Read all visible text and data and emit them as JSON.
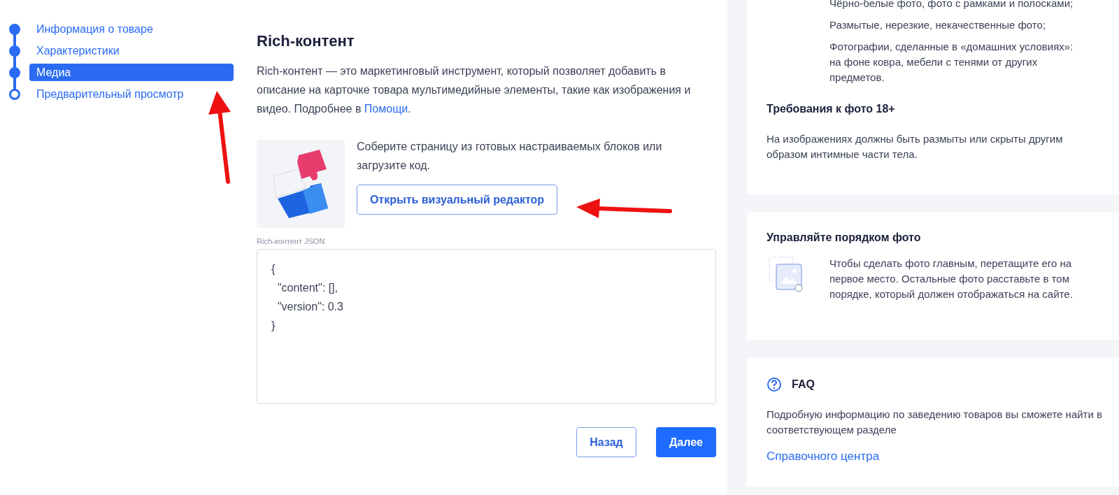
{
  "steps": [
    {
      "label": "Информация о товаре",
      "done": true,
      "selected": false
    },
    {
      "label": "Характеристики",
      "done": true,
      "selected": false
    },
    {
      "label": "Медиа",
      "done": true,
      "selected": true
    },
    {
      "label": "Предварительный просмотр",
      "done": false,
      "selected": false
    }
  ],
  "main": {
    "title": "Rich-контент",
    "description": "Rich-контент — это маркетинговый инструмент, который позволяет добавить в описание на карточке товара мультимедийные элементы, такие как изображения и видео. Подробнее в ",
    "help_link": "Помощи",
    "description_end": ".",
    "editor_text": "Соберите страницу из готовых настраиваемых блоков или загрузите код.",
    "editor_button": "Открыть визуальный редактор",
    "json_label": "Rich-контент JSON",
    "json_value": "{\n  \"content\": [],\n  \"version\": 0.3\n}",
    "back_button": "Назад",
    "next_button": "Далее"
  },
  "side": {
    "bullets": [
      "Чёрно-белые фото, фото с рамками и полосками;",
      "Размытые, нерезкие, некачественные фото;",
      "Фотографии, сделанные в «домашних условиях»: на фоне ковра, мебели с тенями от других предметов."
    ],
    "adult_title": "Требования к фото 18+",
    "adult_text": "На изображениях должны быть размыты или скрыты другим образом интимные части тела.",
    "order_title": "Управляйте порядком фото",
    "order_text": "Чтобы сделать фото главным, перетащите его на первое место. Остальные фото расставьте в том порядке, который должен отображаться на сайте.",
    "faq_title": "FAQ",
    "faq_text": "Подробную информацию по заведению товаров вы сможете найти в соответствующем разделе",
    "faq_link": "Справочного центра"
  }
}
